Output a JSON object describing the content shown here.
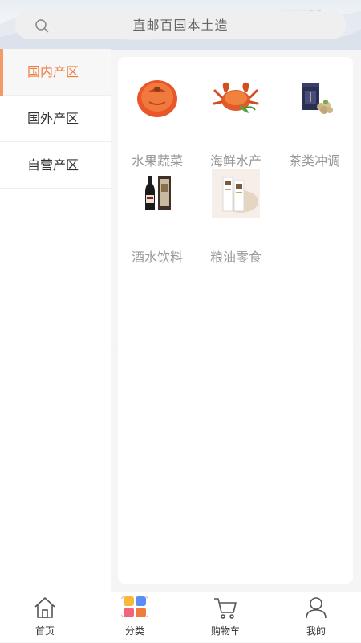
{
  "search": {
    "placeholder": "直邮百国本土造"
  },
  "sidebar": {
    "items": [
      {
        "label": "国内产区",
        "active": true
      },
      {
        "label": "国外产区",
        "active": false
      },
      {
        "label": "自营产区",
        "active": false
      }
    ]
  },
  "categories": [
    {
      "label": "水果蔬菜",
      "icon": "persimmon-image"
    },
    {
      "label": "海鲜水产",
      "icon": "crab-image"
    },
    {
      "label": "茶类冲调",
      "icon": "tea-can-image"
    },
    {
      "label": "酒水饮料",
      "icon": "wine-bottle-image"
    },
    {
      "label": "粮油零食",
      "icon": "snack-box-image"
    }
  ],
  "tabbar": {
    "items": [
      {
        "label": "首页",
        "icon": "home-icon"
      },
      {
        "label": "分类",
        "icon": "category-icon"
      },
      {
        "label": "购物车",
        "icon": "cart-icon"
      },
      {
        "label": "我的",
        "icon": "user-icon"
      }
    ]
  },
  "colors": {
    "accent": "#ee7c3c",
    "muted_label": "#999999"
  }
}
